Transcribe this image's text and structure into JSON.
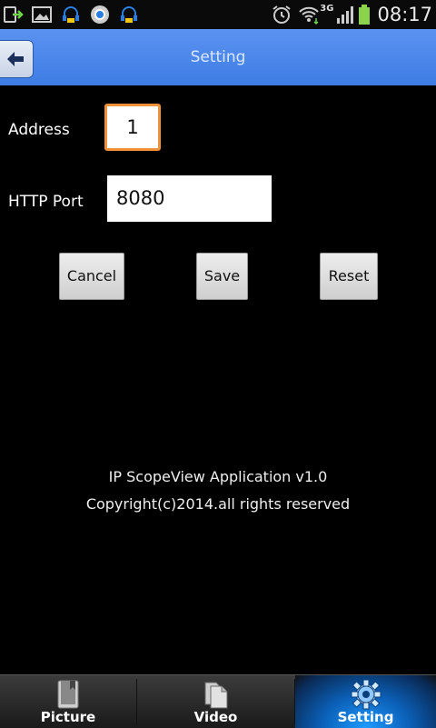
{
  "status_bar": {
    "network": "3G",
    "time": "08:17"
  },
  "header": {
    "title": "Setting",
    "back_icon": "back-arrow-icon"
  },
  "form": {
    "address_label": "Address",
    "address_value": "1",
    "port_label": "HTTP Port",
    "port_value": "8080"
  },
  "buttons": {
    "cancel": "Cancel",
    "save": "Save",
    "reset": "Reset"
  },
  "info": {
    "app_name": "IP ScopeView Application v1.0",
    "copyright": "Copyright(c)2014.all rights reserved"
  },
  "tabs": [
    {
      "label": "Picture",
      "icon": "book-icon",
      "active": false
    },
    {
      "label": "Video",
      "icon": "documents-icon",
      "active": false
    },
    {
      "label": "Setting",
      "icon": "gear-icon",
      "active": true
    }
  ],
  "colors": {
    "title_bar": "#4a86e8",
    "focus_border": "#f0923a",
    "active_tab": "#1e9bff"
  }
}
